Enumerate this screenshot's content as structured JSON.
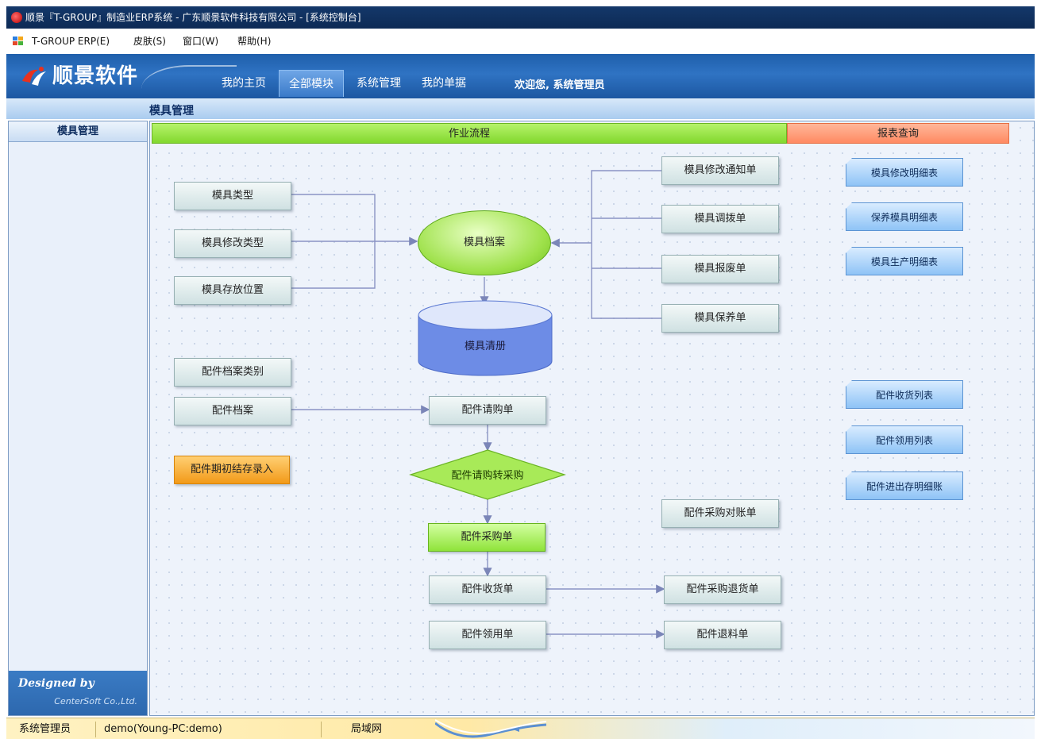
{
  "window": {
    "title": "顺景『T-GROUP』制造业ERP系统 - 广东顺景软件科技有限公司 - [系统控制台]"
  },
  "menu": {
    "items": [
      "T-GROUP ERP(E)",
      "皮肤(S)",
      "窗口(W)",
      "帮助(H)"
    ]
  },
  "banner": {
    "logo_text": "顺景软件",
    "tabs": [
      "我的主页",
      "全部模块",
      "系统管理",
      "我的单据"
    ],
    "active_tab": "全部模块",
    "welcome": "欢迎您, 系统管理员"
  },
  "breadcrumb": "模具管理",
  "sidebar": {
    "header": "模具管理",
    "credit_line1": "Designed by",
    "credit_line2": "CenterSoft Co.,Ltd."
  },
  "main": {
    "flow_header": "作业流程",
    "report_header": "报表查询",
    "left_boxes": [
      "模具类型",
      "模具修改类型",
      "模具存放位置",
      "配件档案类别",
      "配件档案",
      "配件期初结存录入"
    ],
    "center": {
      "ellipse": "模具档案",
      "cylinder": "模具清册",
      "purchase_request": "配件请购单",
      "diamond": "配件请购转采购",
      "purchase_order": "配件采购单",
      "receipt": "配件收货单",
      "requisition": "配件领用单"
    },
    "right_boxes": [
      "模具修改通知单",
      "模具调拨单",
      "模具报废单",
      "模具保养单",
      "配件采购对账单",
      "配件采购退货单",
      "配件退料单"
    ],
    "reports": [
      "模具修改明细表",
      "保养模具明细表",
      "模具生产明细表",
      "配件收货列表",
      "配件领用列表",
      "配件进出存明细账"
    ]
  },
  "statusbar": {
    "user": "系统管理员",
    "session": "demo(Young-PC:demo)",
    "network": "局域网"
  },
  "colors": {
    "title_bar": "#0d2a55",
    "banner_blue": "#2f73c3",
    "flow_header_green": "#82d82e",
    "report_header_orange": "#ff8a62",
    "report_button_blue": "#8ec3f6",
    "highlight_orange": "#f29a18",
    "highlight_green": "#8fe33a"
  },
  "icons": [
    "app-logo-icon",
    "erp-menu-icon",
    "company-logo-icon",
    "network-icon"
  ]
}
